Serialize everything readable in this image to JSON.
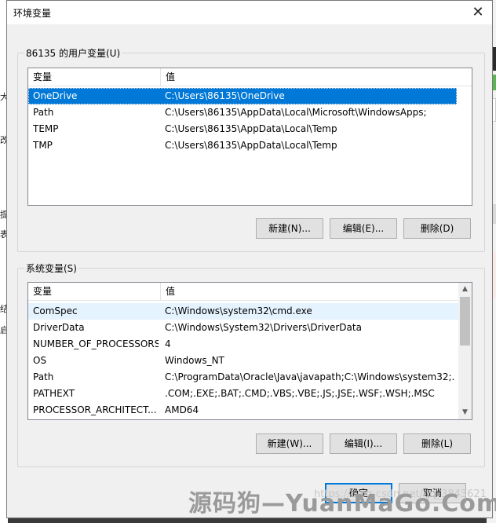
{
  "dialog": {
    "title": "环境变量",
    "close_glyph": "✕"
  },
  "user_vars": {
    "group_label": "86135 的用户变量(U)",
    "col_name": "变量",
    "col_value": "值",
    "rows": [
      {
        "name": "OneDrive",
        "value": "C:\\Users\\86135\\OneDrive"
      },
      {
        "name": "Path",
        "value": "C:\\Users\\86135\\AppData\\Local\\Microsoft\\WindowsApps;"
      },
      {
        "name": "TEMP",
        "value": "C:\\Users\\86135\\AppData\\Local\\Temp"
      },
      {
        "name": "TMP",
        "value": "C:\\Users\\86135\\AppData\\Local\\Temp"
      }
    ],
    "buttons": {
      "new": "新建(N)...",
      "edit": "编辑(E)...",
      "delete": "删除(D)"
    }
  },
  "system_vars": {
    "group_label": "系统变量(S)",
    "col_name": "变量",
    "col_value": "值",
    "rows": [
      {
        "name": "ComSpec",
        "value": "C:\\Windows\\system32\\cmd.exe"
      },
      {
        "name": "DriverData",
        "value": "C:\\Windows\\System32\\Drivers\\DriverData"
      },
      {
        "name": "NUMBER_OF_PROCESSORS",
        "value": "4"
      },
      {
        "name": "OS",
        "value": "Windows_NT"
      },
      {
        "name": "Path",
        "value": "C:\\ProgramData\\Oracle\\Java\\javapath;C:\\Windows\\system32;..."
      },
      {
        "name": "PATHEXT",
        "value": ".COM;.EXE;.BAT;.CMD;.VBS;.VBE;.JS;.JSE;.WSF;.WSH;.MSC"
      },
      {
        "name": "PROCESSOR_ARCHITECT...",
        "value": "AMD64"
      }
    ],
    "buttons": {
      "new": "新建(W)...",
      "edit": "编辑(I)...",
      "delete": "删除(L)"
    }
  },
  "footer": {
    "ok": "确定",
    "cancel": "取消"
  },
  "watermark": {
    "main": "源码狗—YuanMaGo.Com",
    "sub": "https://blog.csdn.net/qq_3843621"
  },
  "background": {
    "fragments": [
      "大",
      "改",
      "提",
      "表",
      "结",
      "启"
    ]
  },
  "colors": {
    "selection": "#0078d7",
    "accent": "#0078d7"
  }
}
